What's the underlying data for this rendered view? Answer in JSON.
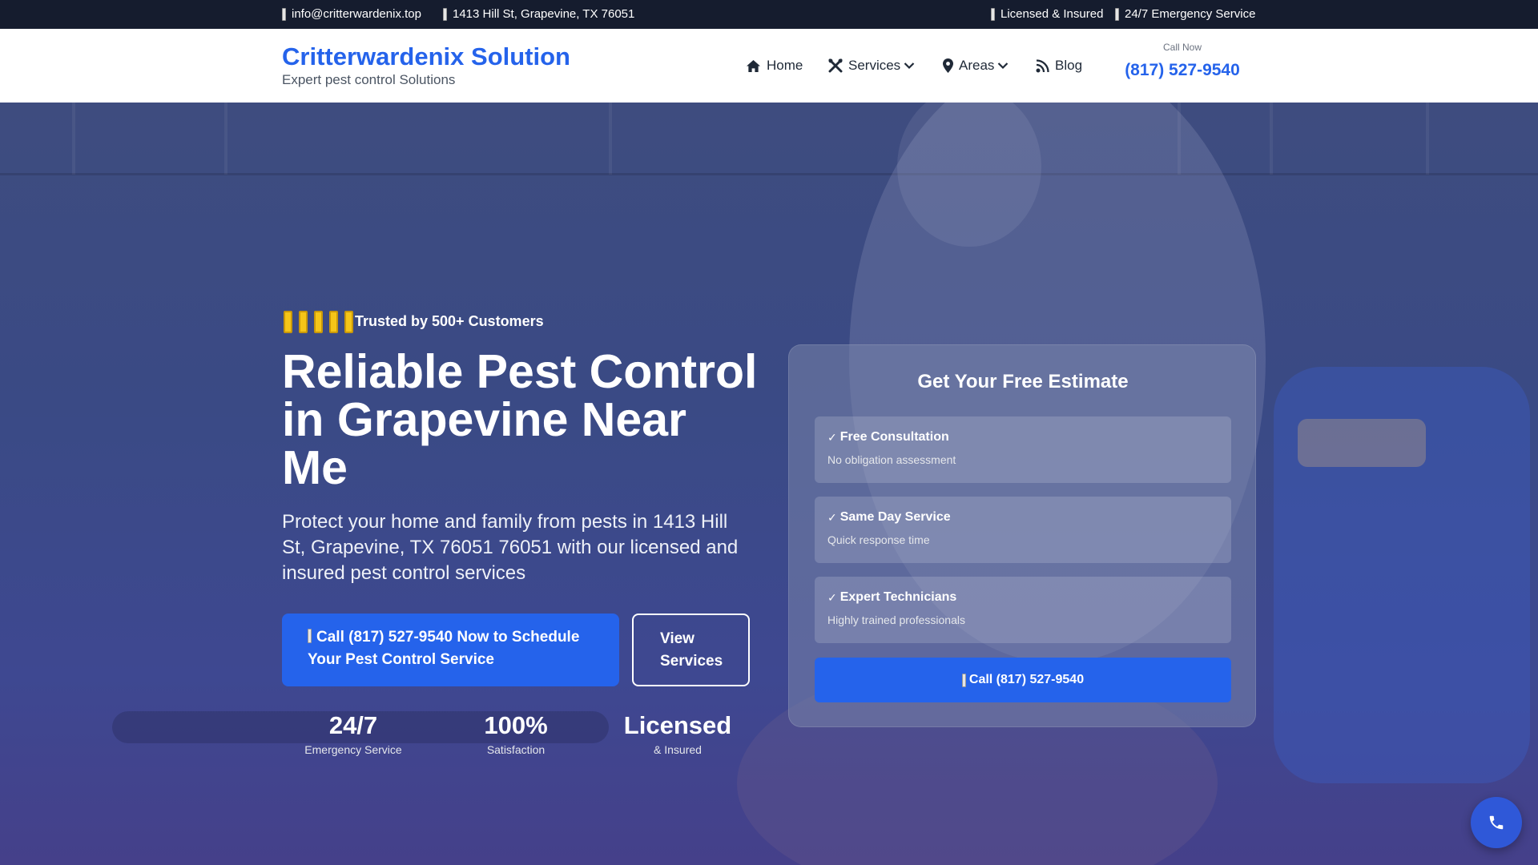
{
  "topbar": {
    "email": "info@critterwardenix.top",
    "address": "1413 Hill St, Grapevine, TX 76051",
    "licensed": "Licensed & Insured",
    "emergency": "24/7 Emergency Service"
  },
  "header": {
    "brand_title": "Critterwardenix Solution",
    "brand_subtitle": "Expert pest control Solutions",
    "nav": {
      "home": "Home",
      "services": "Services",
      "areas": "Areas",
      "blog": "Blog"
    },
    "call_label": "Call Now",
    "call_number": "(817) 527-9540"
  },
  "hero": {
    "stars": 5,
    "trusted": "Trusted by 500+ Customers",
    "title": "Reliable Pest Control in Grapevine Near Me",
    "subtitle": "Protect your home and family from pests in 1413 Hill St, Grapevine, TX 76051 76051 with our licensed and insured pest control services",
    "primary_button": "Call (817) 527-9540 Now to Schedule Your Pest Control Service",
    "secondary_button": "View Services",
    "stats": [
      {
        "value": "24/7",
        "label": "Emergency Service"
      },
      {
        "value": "100%",
        "label": "Satisfaction"
      },
      {
        "value": "Licensed",
        "label": "& Insured"
      }
    ]
  },
  "estimate": {
    "title": "Get Your Free Estimate",
    "features": [
      {
        "title": "Free Consultation",
        "desc": "No obligation assessment"
      },
      {
        "title": "Same Day Service",
        "desc": "Quick response time"
      },
      {
        "title": "Expert Technicians",
        "desc": "Highly trained professionals"
      }
    ],
    "button": "Call (817) 527-9540"
  },
  "colors": {
    "accent": "#2563eb",
    "topbar": "#151c2e",
    "star": "#f5c518"
  },
  "icons": {
    "home": "home-icon",
    "services": "tools-icon",
    "areas": "map-pin-icon",
    "blog": "rss-icon",
    "float": "phone-icon"
  }
}
